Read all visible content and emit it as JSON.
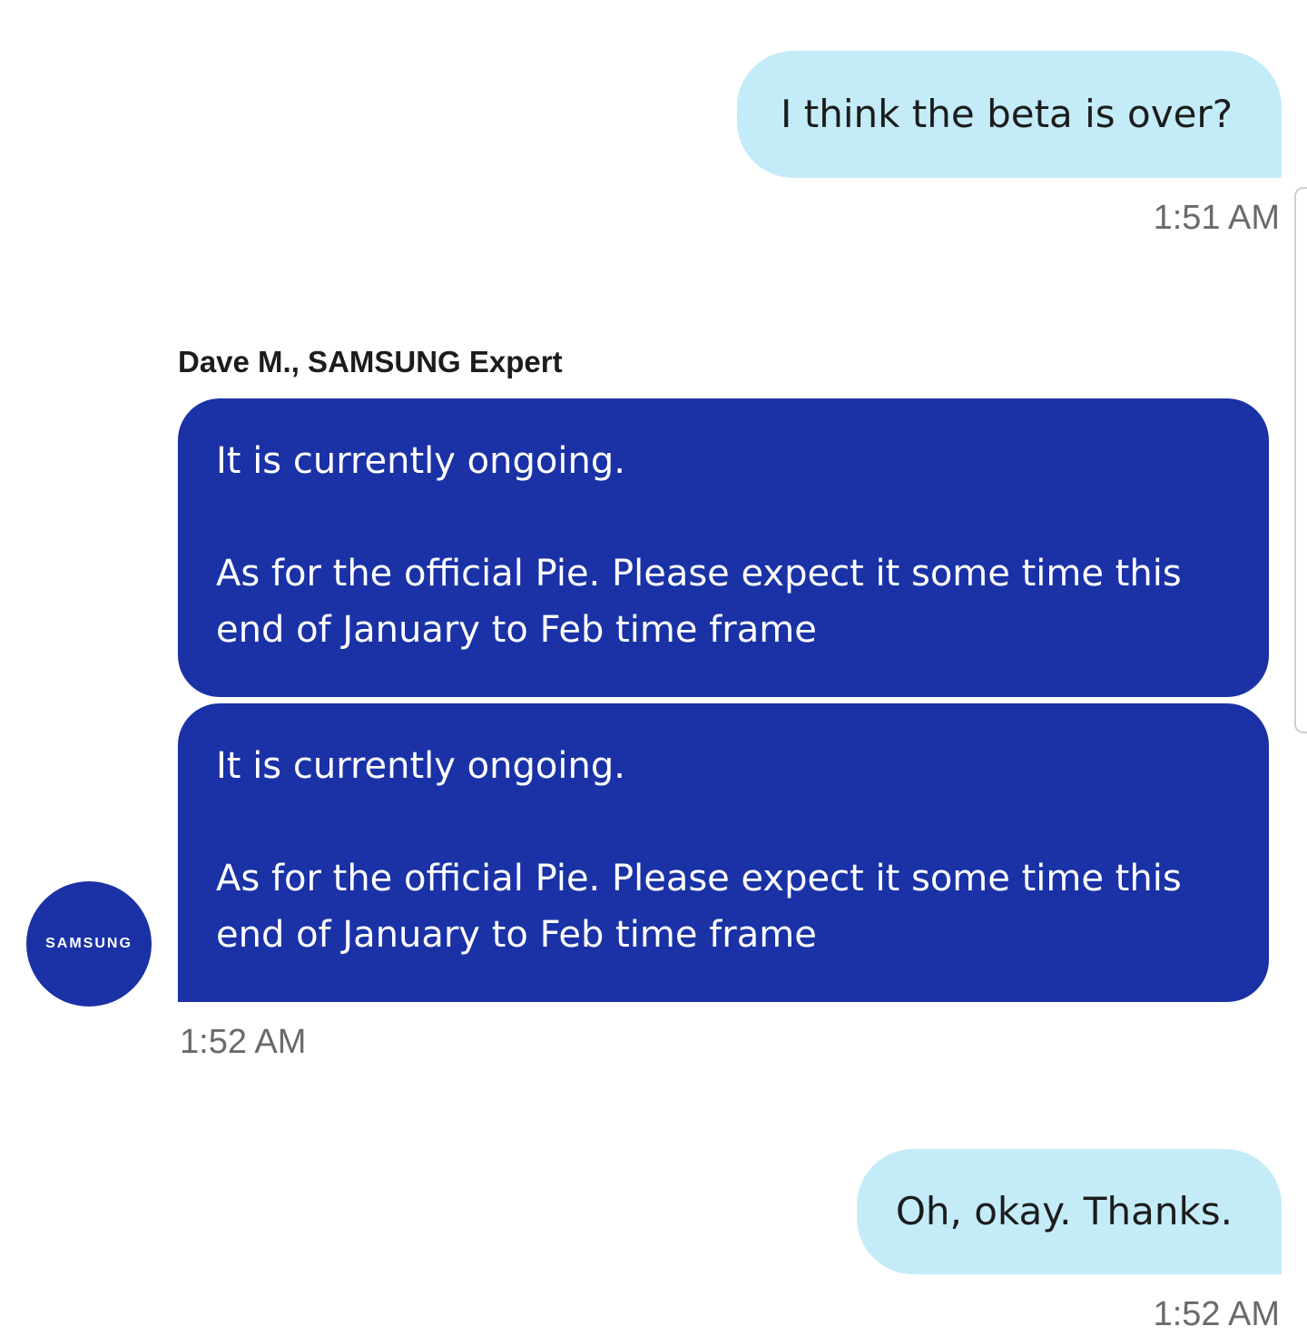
{
  "conversation": {
    "messages": [
      {
        "side": "user",
        "text": "I think the beta is over?",
        "time": "1:51 AM"
      },
      {
        "side": "agent",
        "sender": "Dave M., SAMSUNG Expert",
        "text": "It is currently ongoing.\n\nAs for the official Pie. Please expect it some time this end of January to Feb time frame"
      },
      {
        "side": "agent",
        "text": "It is currently ongoing.\n\nAs for the official Pie. Please expect it some time this end of January to Feb time frame",
        "time": "1:52 AM"
      },
      {
        "side": "user",
        "text": "Oh, okay. Thanks.",
        "time": "1:52 AM"
      }
    ],
    "avatar_label": "SAMSUNG",
    "avatar_icon": "samsung-logo-icon"
  },
  "colors": {
    "user_bubble": "#c3ecf8",
    "agent_bubble": "#1a32a6",
    "timestamp": "#6a6a6a"
  }
}
